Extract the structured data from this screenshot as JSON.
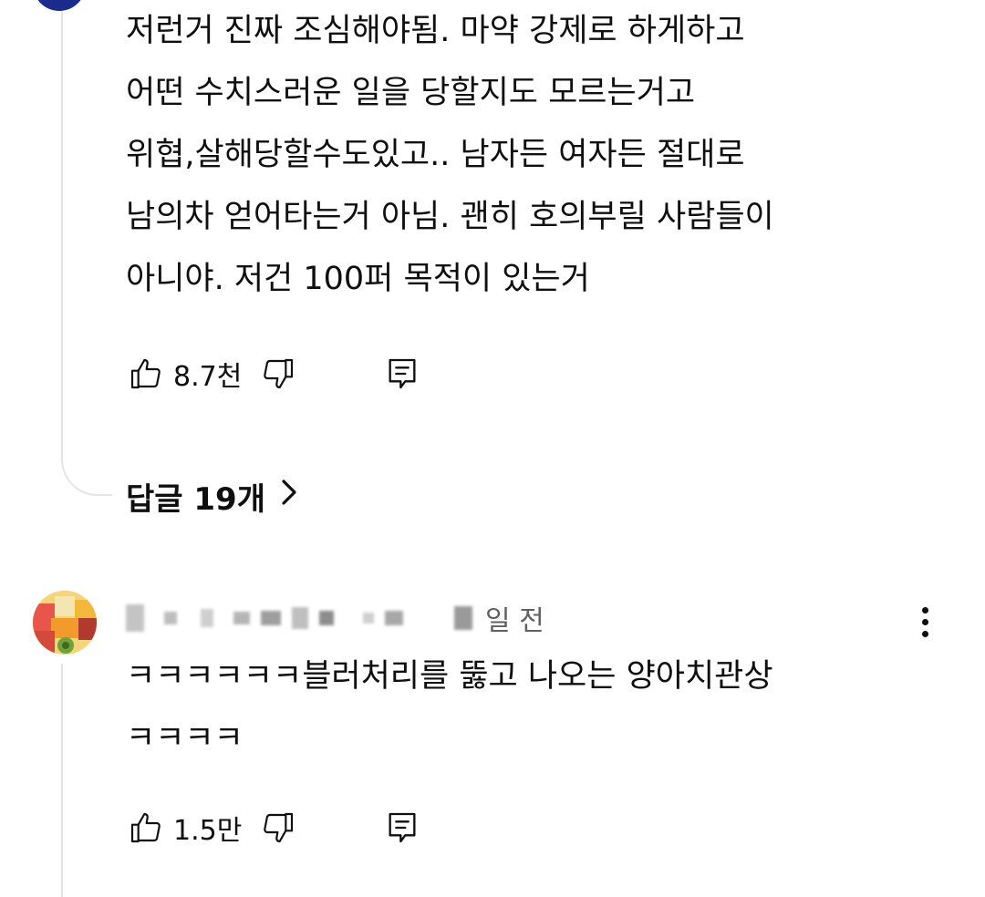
{
  "comment1": {
    "lines": [
      "저런거 진짜 조심해야됨. 마약 강제로 하게하고",
      "어떤 수치스러운 일을 당할지도 모르는거고",
      "위협,살해당할수도있고.. 남자든 여자든 절대로",
      "남의차 얻어타는거 아님. 괜히 호의부릴 사람들이",
      "아니야. 저건 100퍼 목적이 있는거"
    ],
    "like_count": "8.7천",
    "replies_label": "답글 19개"
  },
  "comment2": {
    "time": "일 전",
    "lines": [
      "ㅋㅋㅋㅋㅋㅋ블러처리를 뚫고 나오는 양아치관상",
      "ㅋㅋㅋㅋ"
    ],
    "like_count": "1.5만"
  },
  "icons": {
    "like": "thumbs-up-icon",
    "dislike": "thumbs-down-icon",
    "reply": "reply-icon",
    "chevron": "chevron-right-icon",
    "more": "more-vert-icon"
  },
  "colors": {
    "text": "#0f0f0f",
    "secondary": "#606060",
    "thread_line": "#e5e5e5",
    "avatar_top": "#1a2b8c"
  }
}
